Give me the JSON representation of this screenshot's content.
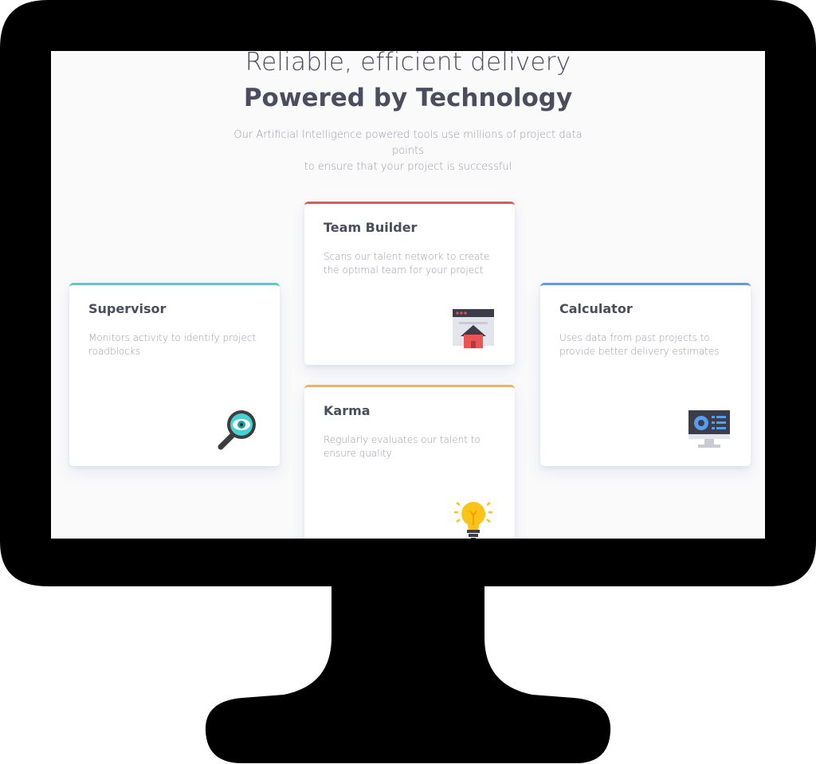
{
  "header": {
    "light": "Reliable, efficient delivery",
    "bold": "Powered by Technology",
    "intro_line1": "Our Artificial Intelligence powered tools use millions of project data points",
    "intro_line2": "to ensure that your project is successful"
  },
  "cards": [
    {
      "title": "Supervisor",
      "description": "Monitors activity to identify project roadblocks",
      "accent": "#44d3d2",
      "icon": "magnifier-eye-icon"
    },
    {
      "title": "Team Builder",
      "description": "Scans our talent network to create the optimal team for your project",
      "accent": "#ea5454",
      "icon": "browser-house-icon"
    },
    {
      "title": "Karma",
      "description": "Regularly evaluates our talent to ensure quality",
      "accent": "#fcaf4a",
      "icon": "lightbulb-icon"
    },
    {
      "title": "Calculator",
      "description": "Uses data from past projects to provide better delivery estimates",
      "accent": "#549ef2",
      "icon": "monitor-chart-icon"
    }
  ]
}
